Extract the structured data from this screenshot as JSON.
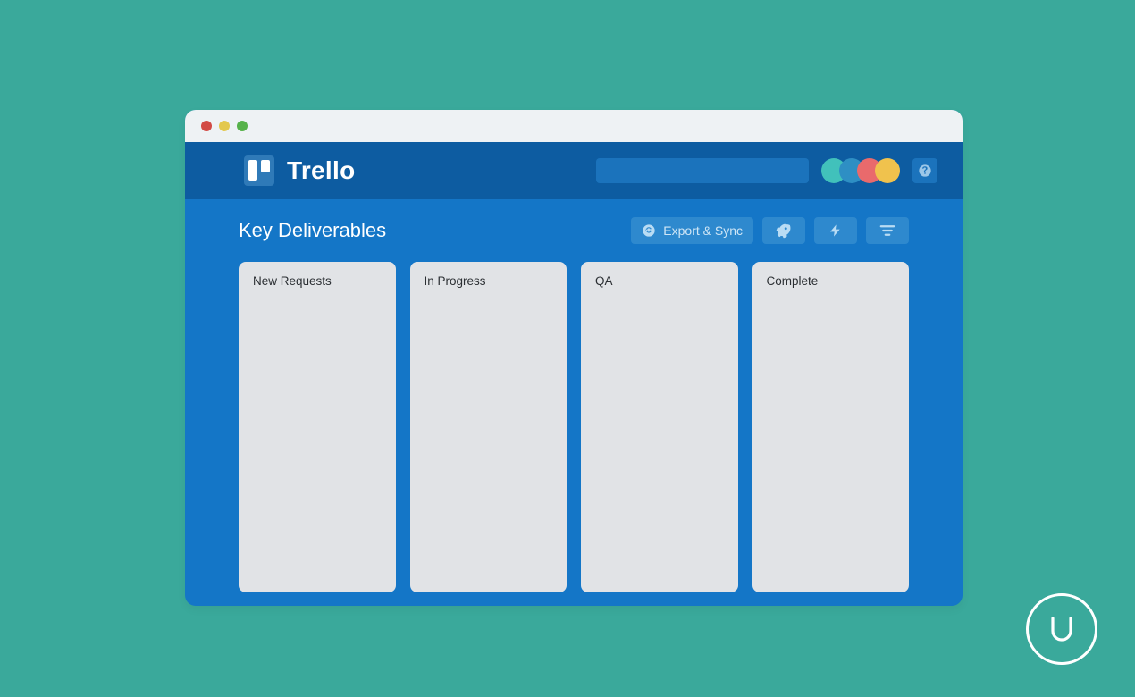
{
  "brand": {
    "name": "Trello"
  },
  "search": {
    "placeholder": ""
  },
  "avatars": [
    {
      "color": "#41c1bb"
    },
    {
      "color": "#2e8fc4"
    },
    {
      "color": "#e96a6c"
    },
    {
      "color": "#f0c24d"
    }
  ],
  "board": {
    "title": "Key Deliverables",
    "actions": {
      "export_sync": "Export & Sync"
    },
    "lists": [
      {
        "title": "New Requests"
      },
      {
        "title": "In Progress"
      },
      {
        "title": "QA"
      },
      {
        "title": "Complete"
      }
    ]
  }
}
